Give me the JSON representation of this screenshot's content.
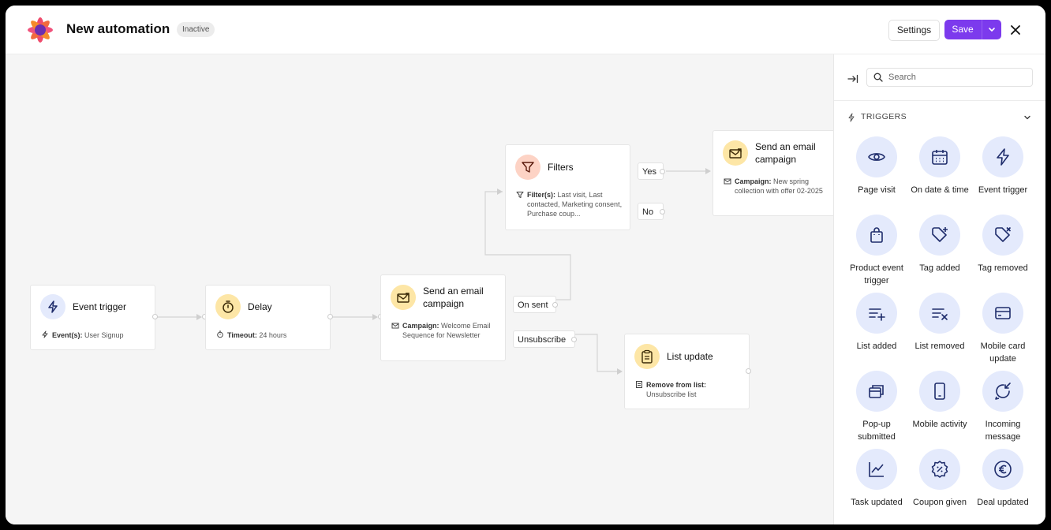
{
  "header": {
    "title": "New automation",
    "status": "Inactive",
    "settings_label": "Settings",
    "save_label": "Save"
  },
  "nodes": {
    "event_trigger": {
      "title": "Event trigger",
      "detail_label": "Event(s):",
      "detail_value": "User Signup"
    },
    "delay": {
      "title": "Delay",
      "detail_label": "Timeout:",
      "detail_value": "24 hours"
    },
    "email1": {
      "title": "Send an email campaign",
      "detail_label": "Campaign:",
      "detail_value": "Welcome Email Sequence for Newsletter"
    },
    "filters": {
      "title": "Filters",
      "detail_label": "Filter(s):",
      "detail_value": "Last visit, Last contacted, Marketing consent, Purchase coup..."
    },
    "email2": {
      "title": "Send an email campaign",
      "detail_label": "Campaign:",
      "detail_value": "New spring collection with offer 02-2025"
    },
    "list_update": {
      "title": "List update",
      "detail_label": "Remove from list:",
      "detail_value": "Unsubscribe list"
    }
  },
  "edge_labels": {
    "yes": "Yes",
    "no": "No",
    "on_sent": "On sent",
    "unsubscribe": "Unsubscribe"
  },
  "panel": {
    "search_placeholder": "Search",
    "section_title": "TRIGGERS",
    "items": [
      {
        "label": "Page visit",
        "icon": "eye-icon"
      },
      {
        "label": "On date & time",
        "icon": "calendar-icon"
      },
      {
        "label": "Event trigger",
        "icon": "lightning-icon"
      },
      {
        "label": "Product event trigger",
        "icon": "shopping-bag-icon"
      },
      {
        "label": "Tag added",
        "icon": "tag-plus-icon"
      },
      {
        "label": "Tag removed",
        "icon": "tag-x-icon"
      },
      {
        "label": "List added",
        "icon": "list-add-icon"
      },
      {
        "label": "List removed",
        "icon": "list-remove-icon"
      },
      {
        "label": "Mobile card update",
        "icon": "card-icon"
      },
      {
        "label": "Pop-up submitted",
        "icon": "popup-icon"
      },
      {
        "label": "Mobile activity",
        "icon": "mobile-icon"
      },
      {
        "label": "Incoming message",
        "icon": "incoming-message-icon"
      },
      {
        "label": "Task updated",
        "icon": "chart-line-icon"
      },
      {
        "label": "Coupon given",
        "icon": "coupon-icon"
      },
      {
        "label": "Deal updated",
        "icon": "euro-icon"
      }
    ]
  },
  "colors": {
    "accent": "#7c3aed",
    "trigger_icon_bg": "#e4eafc",
    "trigger_icon_fg": "#1e2c6b",
    "yellow_icon_bg": "#fde6a6",
    "red_icon_bg": "#fdd3c5"
  }
}
